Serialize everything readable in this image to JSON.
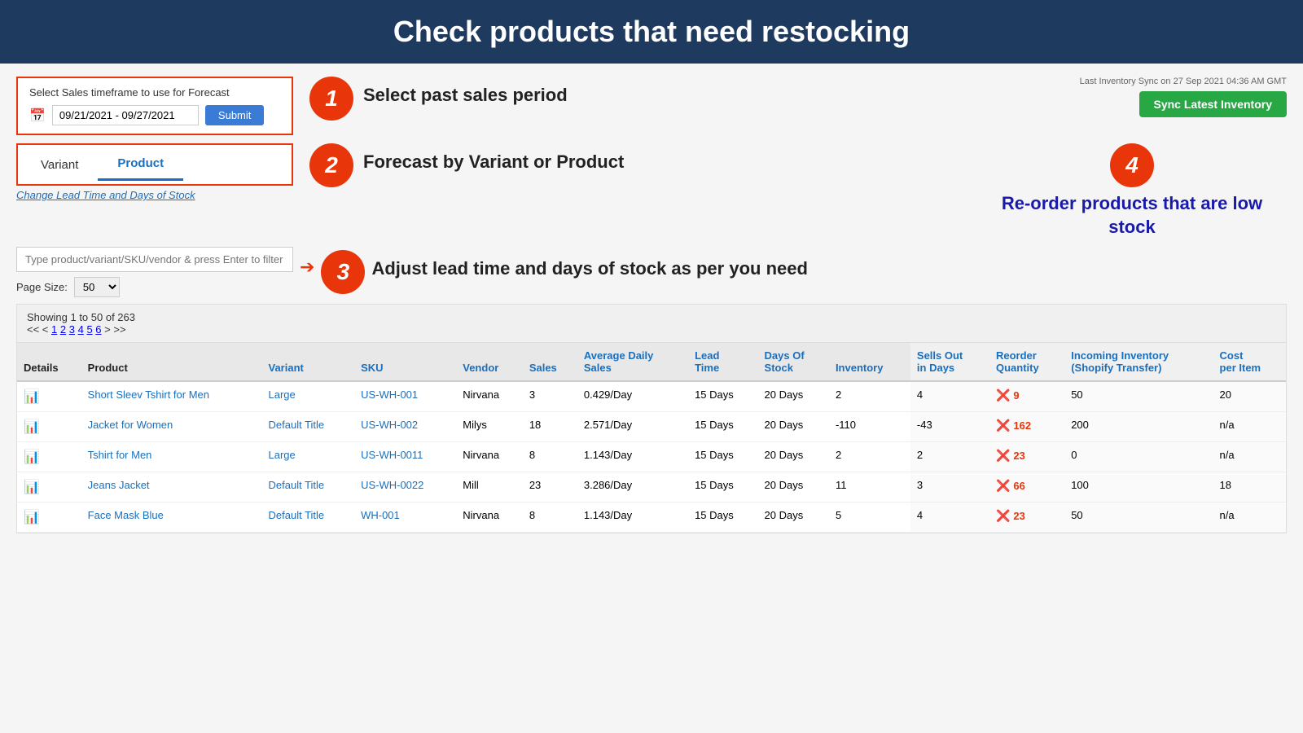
{
  "header": {
    "title": "Check products that need restocking"
  },
  "controls": {
    "salesTimeframeLabel": "Select Sales timeframe to use for Forecast",
    "dateRange": "09/21/2021 - 09/27/2021",
    "submitLabel": "Submit",
    "syncLabel": "Last Inventory Sync on 27 Sep 2021 04:36 AM GMT",
    "syncBtnLabel": "Sync Latest Inventory",
    "tab1": "Variant",
    "tab2": "Product",
    "leadTimeLink": "Change Lead Time and Days of Stock",
    "searchPlaceholder": "Type product/variant/SKU/vendor & press Enter to filter results",
    "pageSizeLabel": "Page Size:",
    "pageSizeValue": "50"
  },
  "steps": {
    "step1": {
      "number": "1",
      "text": "Select past sales period"
    },
    "step2": {
      "number": "2",
      "text": "Forecast  by Variant or Product"
    },
    "step3": {
      "number": "3",
      "text": "Adjust lead time and days of stock as per you need"
    },
    "step4": {
      "number": "4",
      "text": "Re-order products that are low stock"
    }
  },
  "table": {
    "showing": "Showing 1 to 50 of 263",
    "pagination": "<< < 1 2 3 4 5 6 > >>",
    "columns": [
      "Details",
      "Product",
      "Variant",
      "SKU",
      "Vendor",
      "Sales",
      "Average Daily Sales",
      "Lead Time",
      "Days Of Stock",
      "Inventory",
      "Sells Out in Days",
      "Reorder Quantity",
      "Incoming Inventory (Shopify Transfer)",
      "Cost per Item"
    ],
    "rows": [
      {
        "product": "Short Sleev Tshirt for Men",
        "variant": "Large",
        "sku": "US-WH-001",
        "vendor": "Nirvana",
        "sales": "3",
        "avgDailySales": "0.429/Day",
        "leadTime": "15 Days",
        "daysOfStock": "20 Days",
        "inventory": "2",
        "sellsOut": "4",
        "reorderQty": "9",
        "incoming": "50",
        "costPerItem": "20"
      },
      {
        "product": "Jacket for Women",
        "variant": "Default Title",
        "sku": "US-WH-002",
        "vendor": "Milys",
        "sales": "18",
        "avgDailySales": "2.571/Day",
        "leadTime": "15 Days",
        "daysOfStock": "20 Days",
        "inventory": "-110",
        "sellsOut": "-43",
        "reorderQty": "162",
        "incoming": "200",
        "costPerItem": "n/a"
      },
      {
        "product": "Tshirt for Men",
        "variant": "Large",
        "sku": "US-WH-0011",
        "vendor": "Nirvana",
        "sales": "8",
        "avgDailySales": "1.143/Day",
        "leadTime": "15 Days",
        "daysOfStock": "20 Days",
        "inventory": "2",
        "sellsOut": "2",
        "reorderQty": "23",
        "incoming": "0",
        "costPerItem": "n/a"
      },
      {
        "product": "Jeans Jacket",
        "variant": "Default Title",
        "sku": "US-WH-0022",
        "vendor": "Mill",
        "sales": "23",
        "avgDailySales": "3.286/Day",
        "leadTime": "15 Days",
        "daysOfStock": "20 Days",
        "inventory": "11",
        "sellsOut": "3",
        "reorderQty": "66",
        "incoming": "100",
        "costPerItem": "18"
      },
      {
        "product": "Face Mask Blue",
        "variant": "Default Title",
        "sku": "WH-001",
        "vendor": "Nirvana",
        "sales": "8",
        "avgDailySales": "1.143/Day",
        "leadTime": "15 Days",
        "daysOfStock": "20 Days",
        "inventory": "5",
        "sellsOut": "4",
        "reorderQty": "23",
        "incoming": "50",
        "costPerItem": "n/a"
      }
    ]
  }
}
